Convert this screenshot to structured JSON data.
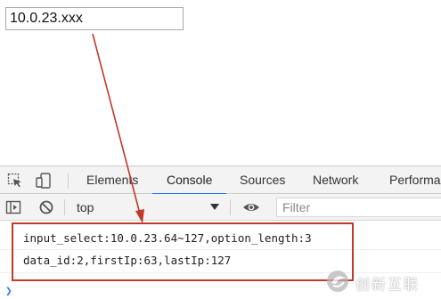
{
  "page": {
    "ip_input_value": "10.0.23.xxx"
  },
  "devtools": {
    "tabs": [
      {
        "label": "Elements",
        "active": false
      },
      {
        "label": "Console",
        "active": true
      },
      {
        "label": "Sources",
        "active": false
      },
      {
        "label": "Network",
        "active": false
      },
      {
        "label": "Performa",
        "active": false
      }
    ],
    "toolbar": {
      "context": "top",
      "filter_placeholder": "Filter"
    },
    "console_lines": [
      "input_select:10.0.23.64~127,option_length:3",
      "data_id:2,firstIp:63,lastIp:127"
    ]
  },
  "watermark": {
    "text": "创新互联"
  },
  "colors": {
    "annotation": "#c0392b",
    "active_tab_underline": "#1a73e8",
    "prompt": "#367cf1"
  }
}
